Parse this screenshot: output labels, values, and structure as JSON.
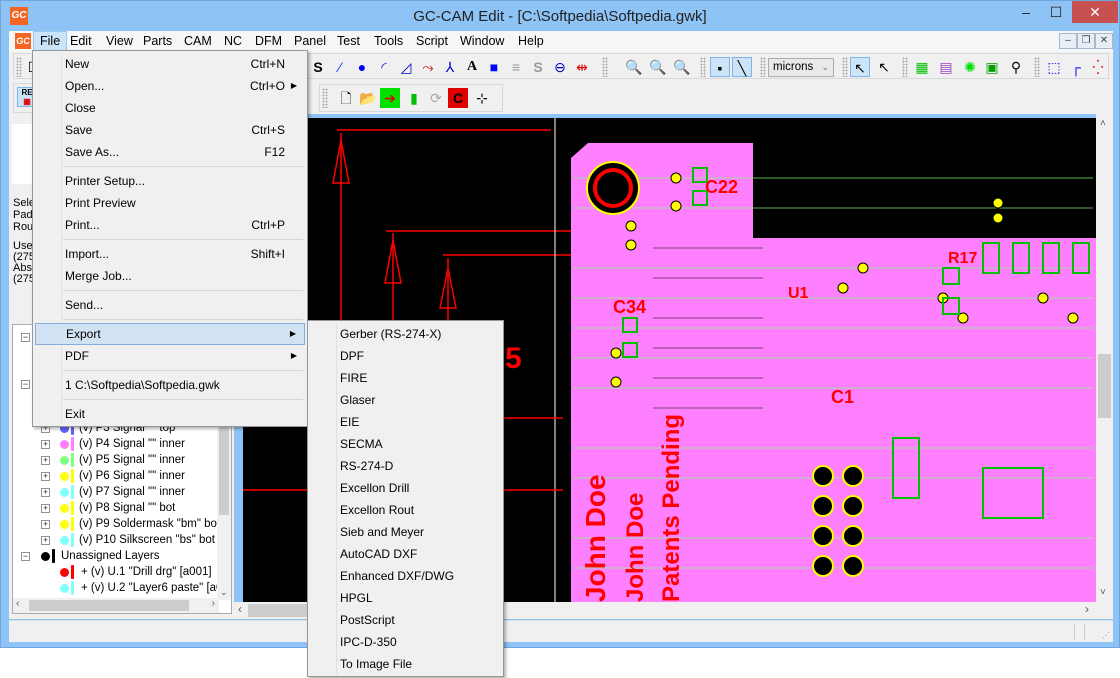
{
  "window": {
    "title": "GC-CAM Edit - [C:\\Softpedia\\Softpedia.gwk]",
    "app_icon_label": "GC",
    "minimize": "‒",
    "maximize": "☐",
    "close": "✕"
  },
  "menubar": {
    "items": [
      "File",
      "Edit",
      "View",
      "Parts",
      "CAM",
      "NC",
      "DFM",
      "Panel",
      "Test",
      "Tools",
      "Script",
      "Window",
      "Help"
    ],
    "active": "File",
    "mdi_buttons": [
      "‒",
      "❐",
      "✕"
    ]
  },
  "toolbar": {
    "units_select": "microns",
    "icons_row1": [
      "new-icon",
      "pencil-icon",
      "flash-icon",
      "arc-icon",
      "corner-icon",
      "trace-icon",
      "junction-icon",
      "text-icon",
      "square-pad-icon",
      "lines-icon",
      "s-icon",
      "circle-icon",
      "measure-icon",
      "zoom-layers-1-icon",
      "zoom-layers-2-icon",
      "zoom-layers-3-icon",
      "point-snap-icon",
      "line-snap-icon",
      "select-arrow-icon",
      "select-list-icon",
      "grid-green-icon",
      "grid-pink-icon",
      "component-icon",
      "frame-icon",
      "find-icon",
      "dashed-rect-icon",
      "corner-mark-icon",
      "array-icon"
    ],
    "icons_row2": [
      "doc-new-icon",
      "folder-open-icon",
      "import-arrow-icon",
      "green-rect-icon",
      "rotate-icon",
      "red-c-icon",
      "axis-icon"
    ],
    "re_label": "RE"
  },
  "left_panel": {
    "info_lines": [
      "Sele",
      "Pad",
      "Rou",
      "Use",
      "(275",
      "Abs",
      "(275"
    ]
  },
  "layer_tree": {
    "rows": [
      {
        "label": "(v) P3 Signal \"\" top",
        "color": "#6060ff"
      },
      {
        "label": "(v) P4 Signal \"\" inner",
        "color": "#ff80ff"
      },
      {
        "label": "(v) P5 Signal \"\" inner",
        "color": "#80ff80"
      },
      {
        "label": "(v) P6 Signal \"\" inner",
        "color": "#ffff00"
      },
      {
        "label": "(v) P7 Signal \"\" inner",
        "color": "#80ffff"
      },
      {
        "label": "(v) P8 Signal \"\" bot",
        "color": "#ffff00"
      },
      {
        "label": "(v) P9 Soldermask \"bm\" bot",
        "color": "#ffff00"
      },
      {
        "label": "(v) P10 Silkscreen \"bs\" bot",
        "color": "#80ffff"
      }
    ],
    "group_label": "Unassigned Layers",
    "unassigned": [
      {
        "label": "+ (v) U.1 \"Drill drg\" [a001]",
        "color": "#ff0000"
      },
      {
        "label": "+ (v) U.2 \"Layer6 paste\" [a0.",
        "color": "#80ffff"
      }
    ]
  },
  "file_menu": {
    "items": [
      {
        "label": "New",
        "shortcut": "Ctrl+N"
      },
      {
        "label": "Open...",
        "shortcut": "Ctrl+O",
        "submenu": true
      },
      {
        "label": "Close",
        "shortcut": ""
      },
      {
        "label": "Save",
        "shortcut": "Ctrl+S"
      },
      {
        "label": "Save As...",
        "shortcut": "F12"
      },
      {
        "sep": true
      },
      {
        "label": "Printer Setup...",
        "shortcut": ""
      },
      {
        "label": "Print Preview",
        "shortcut": ""
      },
      {
        "label": "Print...",
        "shortcut": "Ctrl+P"
      },
      {
        "sep": true
      },
      {
        "label": "Import...",
        "shortcut": "Shift+I"
      },
      {
        "label": "Merge Job...",
        "shortcut": ""
      },
      {
        "sep": true
      },
      {
        "label": "Send...",
        "shortcut": ""
      },
      {
        "sep": true
      },
      {
        "label": "Export",
        "shortcut": "",
        "submenu": true,
        "highlighted": true
      },
      {
        "label": "PDF",
        "shortcut": "",
        "submenu": true
      },
      {
        "sep": true
      },
      {
        "label": "1 C:\\Softpedia\\Softpedia.gwk",
        "shortcut": ""
      },
      {
        "sep": true
      },
      {
        "label": "Exit",
        "shortcut": ""
      }
    ]
  },
  "export_menu": {
    "items": [
      "Gerber (RS-274-X)",
      "DPF",
      "FIRE",
      "Glaser",
      "EIE",
      "SECMA",
      "RS-274-D",
      "Excellon Drill",
      "Excellon Rout",
      "Sieb and Meyer",
      "AutoCAD DXF",
      "Enhanced DXF/DWG",
      "HPGL",
      "PostScript",
      "IPC-D-350",
      "To Image File"
    ]
  },
  "canvas": {
    "labels": [
      "C22",
      "C34",
      "U1",
      "C1",
      "R17",
      "John Doe",
      "John Doe",
      "Patents Pending",
      "5"
    ],
    "background": "#000000",
    "board_color": "#ff80ff"
  }
}
